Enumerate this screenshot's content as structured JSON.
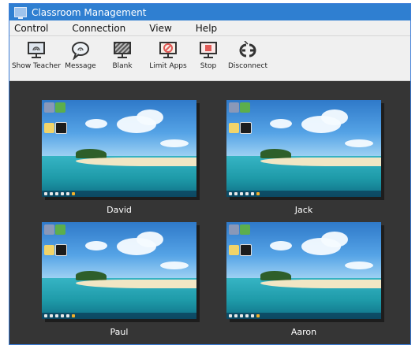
{
  "window": {
    "title": "Classroom Management"
  },
  "menu": [
    {
      "label": "Control"
    },
    {
      "label": "Connection"
    },
    {
      "label": "View"
    },
    {
      "label": "Help"
    }
  ],
  "toolbar": [
    {
      "label": "Show Teacher",
      "icon": "monitor-icon"
    },
    {
      "label": "Message",
      "icon": "speech-bubble-icon"
    },
    {
      "label": "Blank",
      "icon": "blank-screen-icon"
    },
    {
      "label": "Limit Apps",
      "icon": "no-symbol-icon"
    },
    {
      "label": "Stop",
      "icon": "stop-icon"
    },
    {
      "label": "Disconnect",
      "icon": "unplug-icon"
    }
  ],
  "students": [
    {
      "name": "David"
    },
    {
      "name": "Jack"
    },
    {
      "name": "Paul"
    },
    {
      "name": "Aaron"
    }
  ],
  "colors": {
    "titlebar": "#2f7fd1",
    "content_bg": "#353535",
    "stop_red": "#e05a57"
  }
}
